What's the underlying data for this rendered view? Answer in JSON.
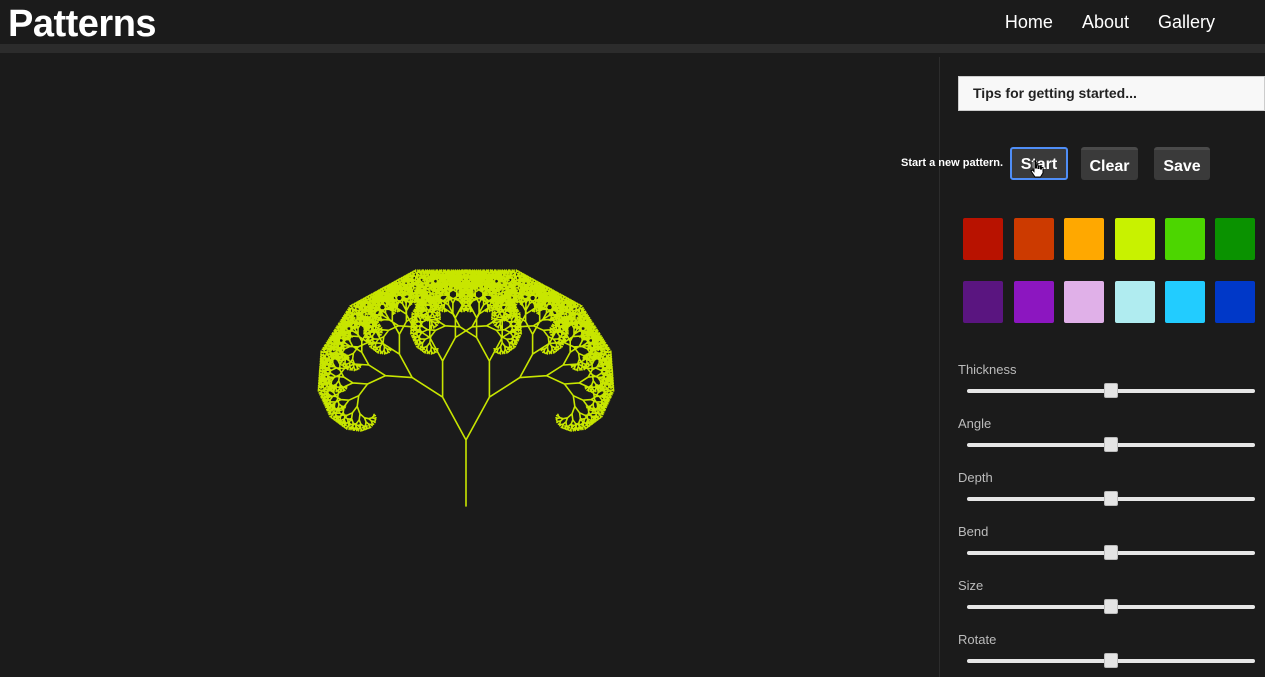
{
  "header": {
    "brand": "Patterns",
    "nav": [
      {
        "label": "Home"
      },
      {
        "label": "About"
      },
      {
        "label": "Gallery"
      }
    ]
  },
  "panel": {
    "tips_label": "Tips for getting started...",
    "hint": "Start a new pattern.",
    "buttons": {
      "start": "Start",
      "clear": "Clear",
      "save": "Save"
    },
    "swatches": [
      "#b81200",
      "#cc3a00",
      "#ffa800",
      "#c8f200",
      "#4cd600",
      "#0a9200",
      "#5a1580",
      "#8c16c0",
      "#e0b0e8",
      "#b0ecf0",
      "#22ccff",
      "#0038c8"
    ],
    "sliders": [
      {
        "label": "Thickness",
        "value": 0.5
      },
      {
        "label": "Angle",
        "value": 0.5
      },
      {
        "label": "Depth",
        "value": 0.5
      },
      {
        "label": "Bend",
        "value": 0.5
      },
      {
        "label": "Size",
        "value": 0.5
      },
      {
        "label": "Rotate",
        "value": 0.5
      }
    ]
  },
  "pattern": {
    "stroke_color": "#c8e600"
  }
}
